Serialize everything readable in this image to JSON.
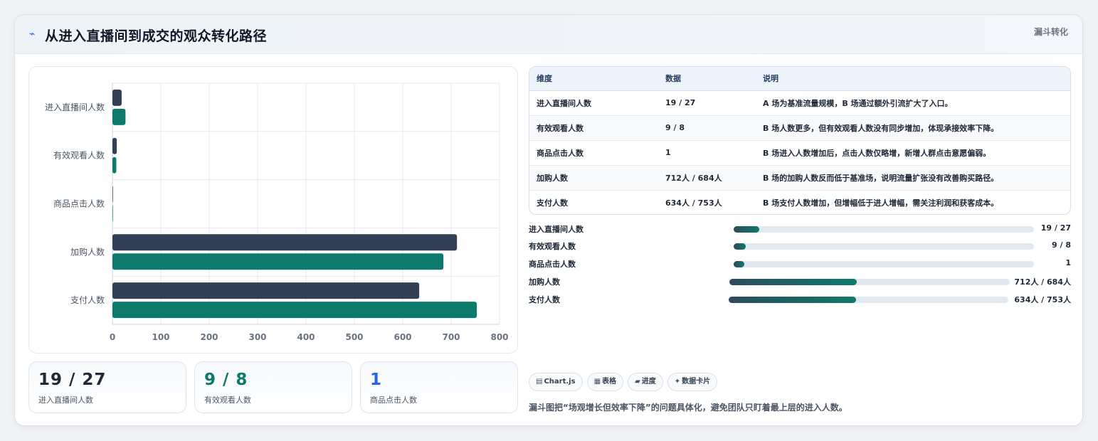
{
  "header": {
    "icon": "lightning-icon",
    "title": "从进入直播间到成交的观众转化路径",
    "tag": "漏斗转化"
  },
  "chart_data": {
    "type": "bar",
    "orientation": "horizontal",
    "categories": [
      "进入直播间人数",
      "有效观看人数",
      "商品点击人数",
      "加购人数",
      "支付人数"
    ],
    "series": [
      {
        "name": "A",
        "color": "#323f55",
        "values": [
          19,
          9,
          1,
          712,
          634
        ]
      },
      {
        "name": "B",
        "color": "#0e7a6c",
        "values": [
          27,
          8,
          1,
          684,
          753
        ]
      }
    ],
    "xlim": [
      0,
      800
    ],
    "xticks": [
      "0",
      "100",
      "200",
      "300",
      "400",
      "500",
      "600",
      "700",
      "800"
    ],
    "grid": true,
    "legend": "none"
  },
  "stats": [
    {
      "value": "19 / 27",
      "label": "进入直播间人数",
      "color": "#1f2937"
    },
    {
      "value": "9 / 8",
      "label": "有效观看人数",
      "color": "#0e7a6c"
    },
    {
      "value": "1",
      "label": "商品点击人数",
      "color": "#2563eb"
    }
  ],
  "table": {
    "headers": [
      "维度",
      "数据",
      "说明"
    ],
    "rows": [
      [
        "进入直播间人数",
        "19 / 27",
        "A 场为基准流量规模，B 场通过额外引流扩大了入口。"
      ],
      [
        "有效观看人数",
        "9 / 8",
        "B 场人数更多，但有效观看人数没有同步增加，体现承接效率下降。"
      ],
      [
        "商品点击人数",
        "1",
        "B 场进入人数增加后，点击人数仅略增，新增人群点击意愿偏弱。"
      ],
      [
        "加购人数",
        "712人 / 684人",
        "B 场的加购人数反而低于基准场，说明流量扩张没有改善购买路径。"
      ],
      [
        "支付人数",
        "634人 / 753人",
        "B 场支付人数增加，但增幅低于进人增幅，需关注利润和获客成本。"
      ]
    ]
  },
  "progress": [
    {
      "label": "进入直播间人数",
      "value": "19 / 27",
      "fraction": 0.085
    },
    {
      "label": "有效观看人数",
      "value": "9 / 8",
      "fraction": 0.04
    },
    {
      "label": "商品点击人数",
      "value": "1",
      "fraction": 0.035
    },
    {
      "label": "加购人数",
      "value": "712人 / 684人",
      "fraction": 0.455
    },
    {
      "label": "支付人数",
      "value": "634人 / 753人",
      "fraction": 0.455
    }
  ],
  "chips": [
    {
      "icon": "chart-icon",
      "glyph": "▤",
      "label": "Chart.js"
    },
    {
      "icon": "table-icon",
      "glyph": "▦",
      "label": "表格"
    },
    {
      "icon": "progress-icon",
      "glyph": "▰",
      "label": "进度"
    },
    {
      "icon": "card-icon",
      "glyph": "✦",
      "label": "数据卡片"
    }
  ],
  "note": "漏斗图把“场观增长但效率下降”的问题具体化，避免团队只盯着最上层的进入人数。"
}
